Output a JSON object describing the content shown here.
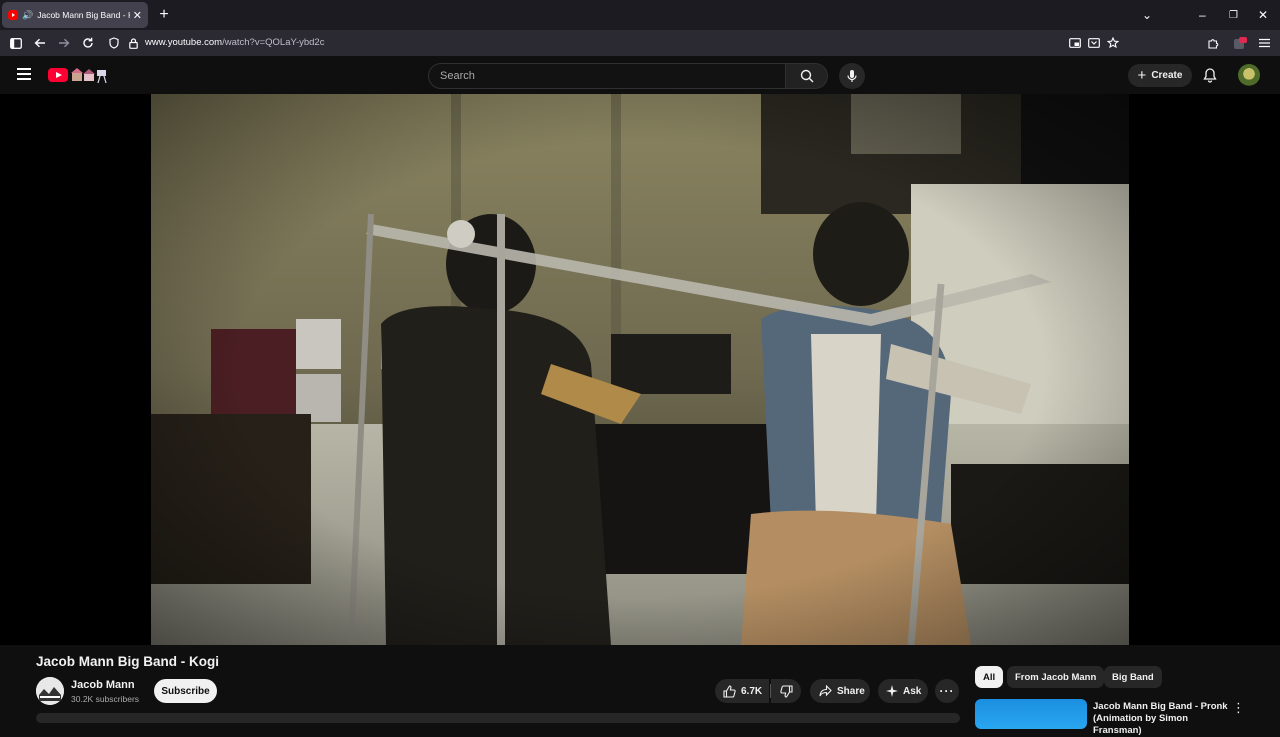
{
  "browser": {
    "tab_title": "Jacob Mann Big Band - Kogi",
    "new_tab": "+",
    "url_host": "www.youtube.com",
    "url_path": "/watch?v=QOLaY-ybd2c"
  },
  "header": {
    "search_placeholder": "Search",
    "create_label": "Create"
  },
  "video": {
    "title": "Jacob Mann Big Band - Kogi"
  },
  "channel": {
    "name": "Jacob Mann",
    "subscribers": "30.2K subscribers",
    "subscribe_label": "Subscribe"
  },
  "actions": {
    "likes": "6.7K",
    "share_label": "Share",
    "ask_label": "Ask",
    "more": "···"
  },
  "chips": [
    "All",
    "From Jacob Mann",
    "Big Band"
  ],
  "recommendation": {
    "title": "Jacob Mann Big Band - Pronk (Animation by Simon Fransman)"
  },
  "colors": {
    "background": "#0f0f0f",
    "brand_red": "#ff0033",
    "chip_bg": "#272727"
  }
}
